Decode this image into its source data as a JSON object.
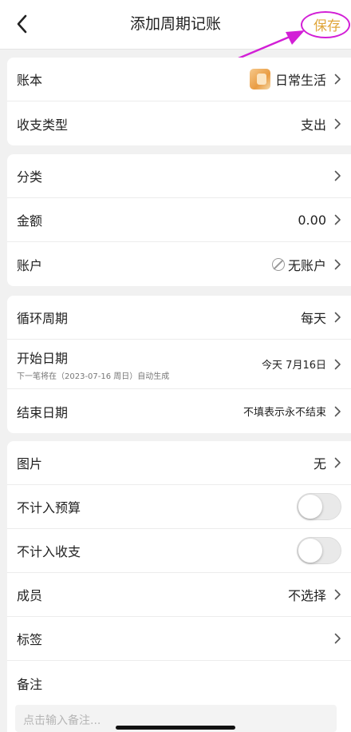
{
  "header": {
    "title": "添加周期记账",
    "save_label": "保存"
  },
  "group1": {
    "book_label": "账本",
    "book_value": "日常生活",
    "type_label": "收支类型",
    "type_value": "支出"
  },
  "group2": {
    "category_label": "分类",
    "amount_label": "金额",
    "amount_value": "0.00",
    "account_label": "账户",
    "account_value": "无账户"
  },
  "group3": {
    "cycle_label": "循环周期",
    "cycle_value": "每天",
    "start_label": "开始日期",
    "start_hint": "下一笔将在（2023-07-16 周日）自动生成",
    "start_value": "今天 7月16日",
    "end_label": "结束日期",
    "end_value": "不填表示永不结束"
  },
  "group4": {
    "image_label": "图片",
    "image_value": "无",
    "exclude_budget_label": "不计入预算",
    "exclude_income_label": "不计入收支",
    "member_label": "成员",
    "member_value": "不选择",
    "tag_label": "标签",
    "remark_label": "备注",
    "remark_placeholder": "点击输入备注..."
  },
  "colors": {
    "accent": "#e0a63a",
    "annotation": "#d21fd6",
    "background": "#f1f1f1"
  },
  "icons": {
    "back": "chevron-left-icon",
    "book": "notebook-icon",
    "no_account": "slash-circle-icon",
    "row_arrow": "chevron-right-icon"
  }
}
